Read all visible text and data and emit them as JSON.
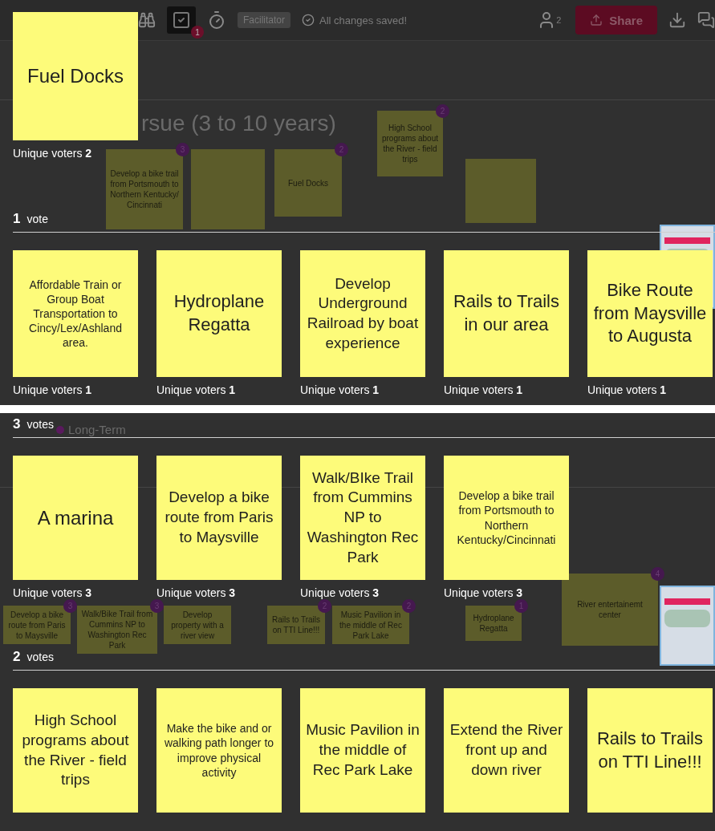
{
  "top_panel": {
    "toolbar": {
      "task_badge": "1",
      "facilitator": "Facilitator",
      "save_status": "All changes saved!",
      "participants": "2",
      "share": "Share"
    },
    "board": {
      "heading": "rsue (3 to 10 years)",
      "notes": [
        {
          "kind": "text",
          "text": "Develop a bike trail from Portsmouth to Northern Kentucky/ Cincinnati",
          "votes": "3"
        },
        {
          "kind": "blank"
        },
        {
          "kind": "text",
          "text": "Fuel Docks",
          "votes": "2"
        },
        {
          "kind": "text",
          "text": "High School programs about the River - field trips",
          "votes": "2"
        },
        {
          "kind": "blank"
        }
      ]
    },
    "top_note": {
      "text": "Fuel Docks",
      "voters": "Unique voters **2**"
    },
    "groups": [
      {
        "count": "1",
        "unit": "vote",
        "notes": [
          {
            "text": "Affordable Train or Group Boat Transportation to Cincy/Lex/Ashland area.",
            "voters": "Unique voters **1**"
          },
          {
            "text": "Hydroplane Regatta",
            "voters": "Unique voters **1**"
          },
          {
            "text": "Develop Underground Railroad by boat experience",
            "voters": "Unique voters **1**"
          },
          {
            "text": "Rails to Trails in our area",
            "voters": "Unique voters **1**"
          },
          {
            "text": "Bike Route from Maysville to Augusta",
            "voters": "Unique voters **1**"
          }
        ]
      }
    ]
  },
  "bottom_panel": {
    "legend": {
      "label": "Long-Term"
    },
    "board": {
      "notes": [
        {
          "kind": "text",
          "text": "Develop a bike route from Paris to Maysville",
          "votes": "3"
        },
        {
          "kind": "text",
          "text": "Walk/Bike Trail from Cummins NP to Washington Rec Park",
          "votes": "3"
        },
        {
          "kind": "text",
          "text": "Develop property with a river view"
        },
        {
          "kind": "text",
          "text": "Rails to Trails on TTI Line!!!",
          "votes": "2"
        },
        {
          "kind": "text",
          "text": "Music Pavilion in the middle of Rec Park Lake",
          "votes": "2"
        },
        {
          "kind": "text",
          "text": "Hydroplane Regatta",
          "votes": "1"
        },
        {
          "kind": "text",
          "text": "River entertainemt center",
          "votes": "4"
        }
      ]
    },
    "groups": [
      {
        "count": "3",
        "unit": "votes",
        "notes": [
          {
            "text": "A marina",
            "voters": "Unique voters **3**"
          },
          {
            "text": "Develop a bike route from Paris to Maysville",
            "voters": "Unique voters **3**"
          },
          {
            "text": "Walk/BIke Trail from Cummins NP to Washington Rec Park",
            "voters": "Unique voters **3**"
          },
          {
            "text": "Develop a bike trail from Portsmouth to Northern Kentucky/Cincinnati",
            "voters": "Unique voters **3**"
          }
        ]
      },
      {
        "count": "2",
        "unit": "votes",
        "notes": [
          {
            "text": "High School programs about the River - field trips"
          },
          {
            "text": "Make the bike and or walking path longer to improve physical activity"
          },
          {
            "text": "Music Pavilion in the middle of Rec Park Lake"
          },
          {
            "text": "Extend the River front up and down river"
          },
          {
            "text": "Rails to Trails on TTI Line!!!"
          }
        ]
      }
    ]
  }
}
